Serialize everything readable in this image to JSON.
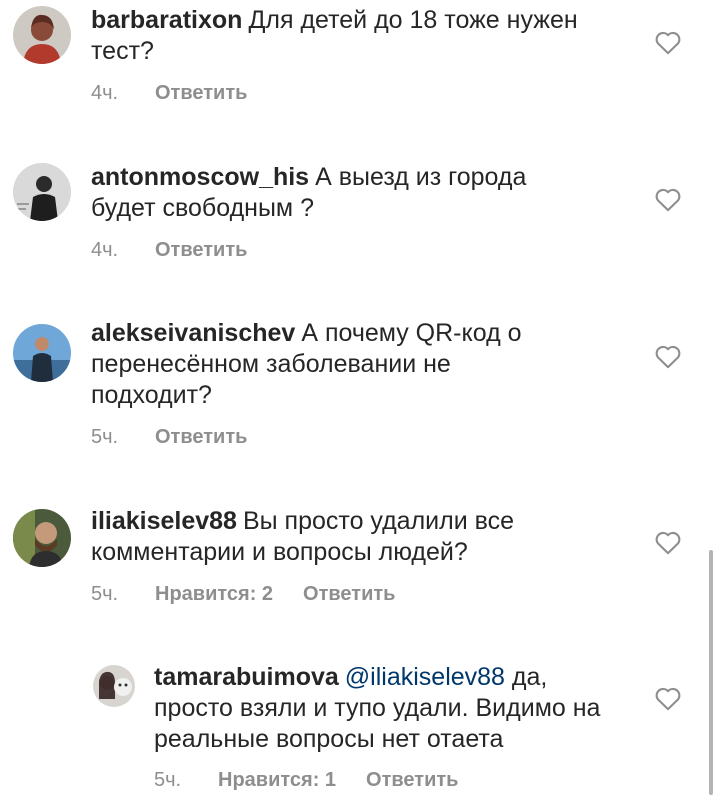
{
  "comments": [
    {
      "username": "barbaratixon",
      "text": "Для детей до 18 тоже нужен тест?",
      "time": "4ч.",
      "reply": "Ответить"
    },
    {
      "username": "antonmoscow_his",
      "text": "А выезд из города будет свободным ?",
      "time": "4ч.",
      "reply": "Ответить"
    },
    {
      "username": "alekseivanischev",
      "text": "А почему QR-код о перенесённом заболевании не подходит?",
      "time": "5ч.",
      "reply": "Ответить"
    },
    {
      "username": "iliakiselev88",
      "text": "Вы просто удалили все комментарии и вопросы людей?",
      "time": "5ч.",
      "likes": "Нравится: 2",
      "reply": "Ответить"
    }
  ],
  "replies": [
    {
      "username": "tamarabuimova",
      "mention": "@iliakiselev88",
      "text": "да, просто взяли и тупо удали. Видимо на реальные вопросы нет отаета",
      "time": "5ч.",
      "likes": "Нравится: 1",
      "reply": "Ответить"
    }
  ],
  "icons": {
    "like": "heart-outline-icon"
  },
  "colors": {
    "text": "#262626",
    "meta": "#8e8e8e",
    "mention": "#00376b",
    "heart_stroke": "#8e8e8e"
  }
}
